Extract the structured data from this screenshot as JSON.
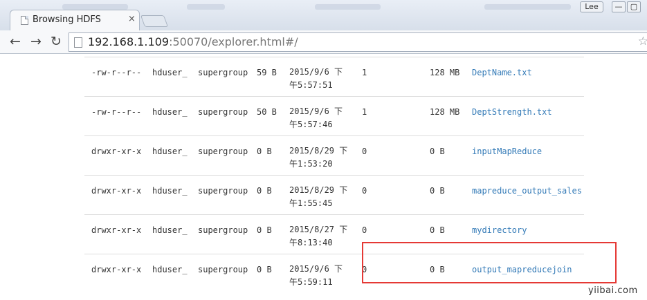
{
  "browser": {
    "tab_title": "Browsing HDFS",
    "tab_close": "×",
    "user_badge": "Lee",
    "window_buttons": {
      "minimize": "—",
      "maximize": "▢"
    },
    "url_host": "192.168.1.109",
    "url_rest": ":50070/explorer.html#/",
    "nav_icons": {
      "back": "←",
      "forward": "→",
      "reload": "↻"
    },
    "bookmark_star": "☆"
  },
  "files": [
    {
      "permission": "-rw-r--r--",
      "owner": "hduser_",
      "group": "supergroup",
      "size": "59 B",
      "date_line1": "2015/9/6 下",
      "date_line2": "午5:57:51",
      "replication": "1",
      "block_size": "128 MB",
      "name": "DeptName.txt"
    },
    {
      "permission": "-rw-r--r--",
      "owner": "hduser_",
      "group": "supergroup",
      "size": "50 B",
      "date_line1": "2015/9/6 下",
      "date_line2": "午5:57:46",
      "replication": "1",
      "block_size": "128 MB",
      "name": "DeptStrength.txt"
    },
    {
      "permission": "drwxr-xr-x",
      "owner": "hduser_",
      "group": "supergroup",
      "size": "0 B",
      "date_line1": "2015/8/29 下",
      "date_line2": "午1:53:20",
      "replication": "0",
      "block_size": "0 B",
      "name": "inputMapReduce"
    },
    {
      "permission": "drwxr-xr-x",
      "owner": "hduser_",
      "group": "supergroup",
      "size": "0 B",
      "date_line1": "2015/8/29 下",
      "date_line2": "午1:55:45",
      "replication": "0",
      "block_size": "0 B",
      "name": "mapreduce_output_sales"
    },
    {
      "permission": "drwxr-xr-x",
      "owner": "hduser_",
      "group": "supergroup",
      "size": "0 B",
      "date_line1": "2015/8/27 下",
      "date_line2": "午8:13:40",
      "replication": "0",
      "block_size": "0 B",
      "name": "mydirectory"
    },
    {
      "permission": "drwxr-xr-x",
      "owner": "hduser_",
      "group": "supergroup",
      "size": "0 B",
      "date_line1": "2015/9/6 下",
      "date_line2": "午5:59:11",
      "replication": "0",
      "block_size": "0 B",
      "name": "output_mapreducejoin"
    }
  ],
  "watermark": "yiibai.com",
  "colors": {
    "link": "#337ab7",
    "highlight": "#e53935"
  }
}
